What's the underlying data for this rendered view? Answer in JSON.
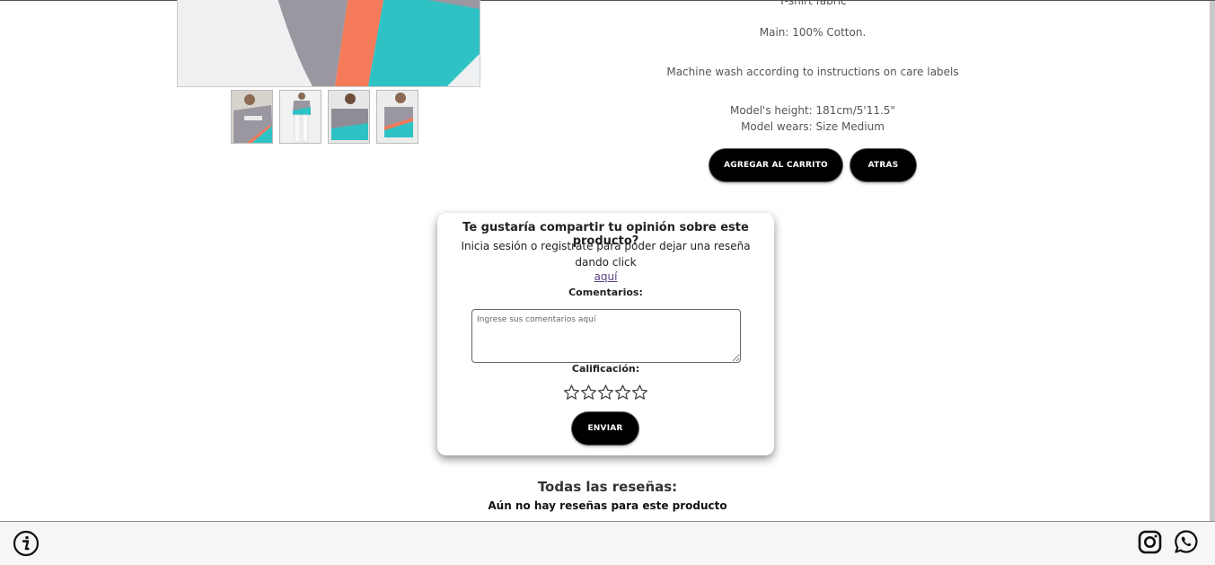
{
  "product": {
    "description": {
      "fabric": "T-shirt fabric",
      "main": "Main: 100% Cotton.",
      "wash": "Machine wash according to instructions on care labels",
      "model_height": "Model's height: 181cm/5'11.5\"",
      "model_wears": "Model wears: Size Medium"
    },
    "thumbnails": [
      "thumb-front",
      "thumb-full",
      "thumb-back",
      "thumb-side"
    ],
    "add_to_cart_label": "AGREGAR AL CARRITO",
    "back_label": "ATRAS"
  },
  "review_form": {
    "title": "Te gustaría compartir tu opinión sobre este producto?",
    "login_text": "Inicia sesión o registrate para poder dejar una reseña dando click",
    "link_text": "aquí",
    "comments_label": "Comentarios:",
    "comments_placeholder": "Ingrese sus comentarios aquí",
    "comments_value": "",
    "rating_label": "Calificación:",
    "rating": 0,
    "rating_max": 5,
    "send_label": "ENVIAR"
  },
  "reviews": {
    "title": "Todas las reseñas:",
    "empty_message": "Aún no hay reseñas para este producto"
  },
  "footer": {
    "icons": [
      "info-icon",
      "instagram-icon",
      "whatsapp-icon"
    ]
  },
  "colors": {
    "shirt_gray": "#9a97a0",
    "shirt_orange": "#f47a5a",
    "shirt_teal": "#2fc2c4",
    "button_bg": "#000000",
    "link": "#5a3e85"
  }
}
